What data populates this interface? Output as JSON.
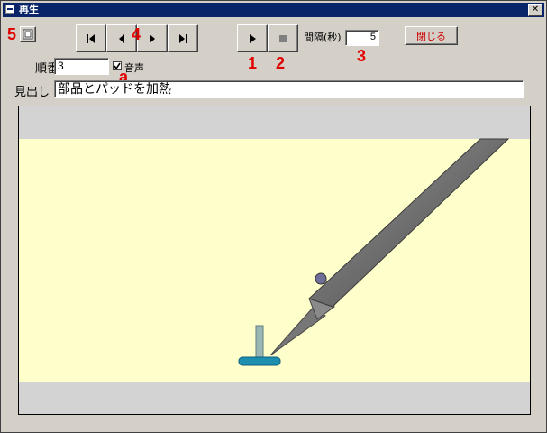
{
  "window": {
    "title": "再生",
    "close_glyph": "✕"
  },
  "toolbar": {
    "settings_marker": "5",
    "nav_marker": "4",
    "play_marker": "1",
    "stop_marker": "2",
    "interval_marker": "3",
    "interval_label": "間隔(秒)",
    "interval_value": "5",
    "close_label": "閉じる",
    "icons": [
      "settings-icon",
      "first-icon",
      "prev-icon",
      "next-icon",
      "last-icon",
      "play-icon",
      "stop-icon"
    ]
  },
  "order": {
    "label": "順番",
    "value": "3"
  },
  "sound": {
    "label": "音声",
    "checked": true,
    "marker": "a"
  },
  "heading": {
    "label": "見出し",
    "value": "部品とパッドを加熱"
  },
  "colors": {
    "titlebar": "#0a246a",
    "marker": "#e00000",
    "panel": "#ffffcc",
    "close_text": "#cc0000",
    "pad": "#1f8fb0"
  }
}
